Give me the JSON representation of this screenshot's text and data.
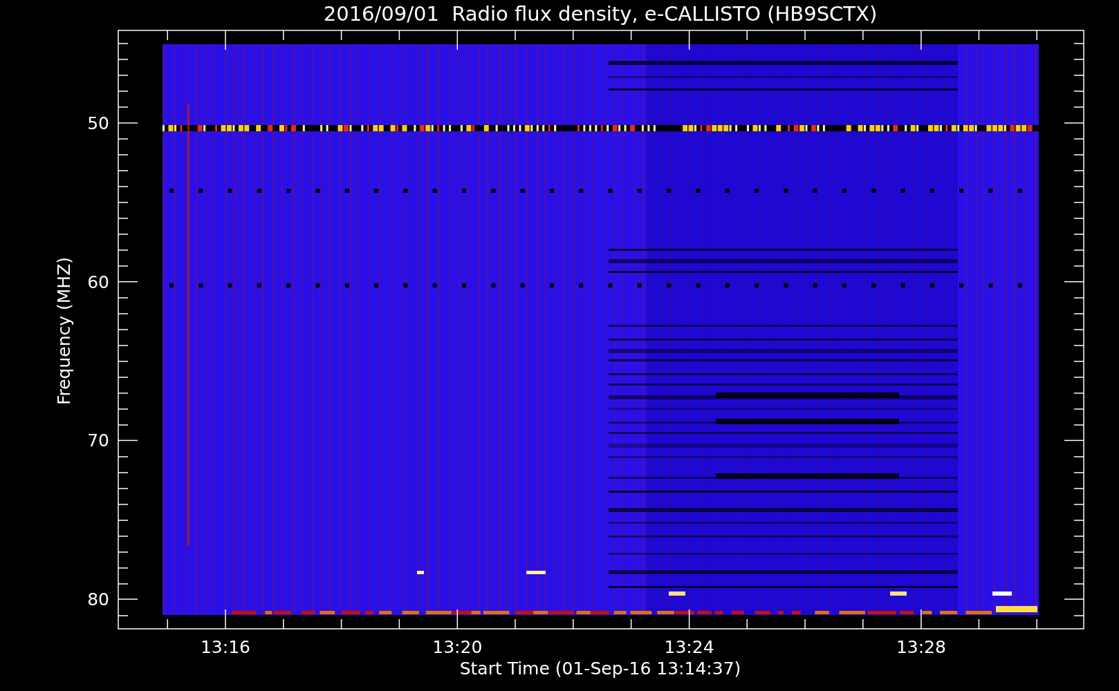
{
  "plot": {
    "title": "2016/09/01  Radio flux density, e-CALLISTO (HB9SCTX)",
    "ylabel": "Frequency (MHZ)",
    "yticks": [
      "50",
      "60",
      "70",
      "80"
    ],
    "xlabel": "Start Time (01-Sep-16 13:14:37)",
    "xticks": [
      "13:16",
      "13:20",
      "13:24",
      "13:28"
    ]
  }
}
